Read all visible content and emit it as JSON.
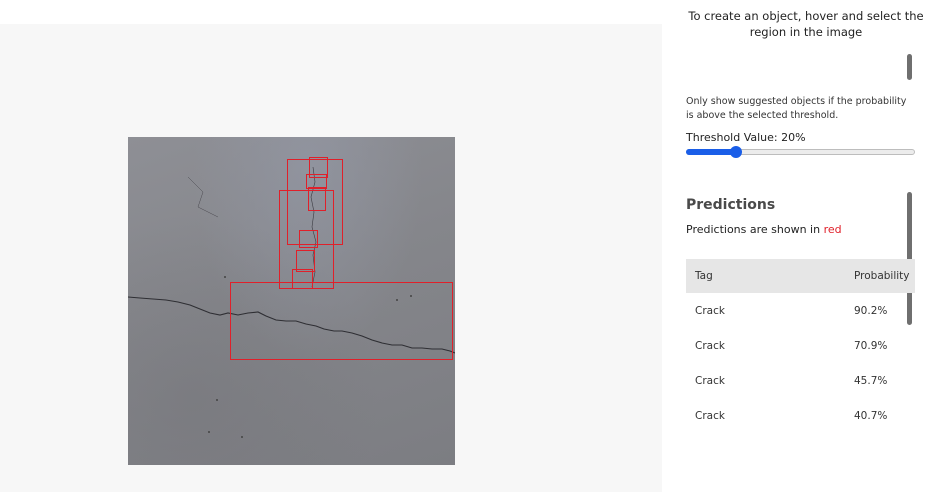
{
  "panel": {
    "instructions": "To create an object, hover and select the region in the image",
    "threshold_note": "Only show suggested objects if the probability is above the selected threshold.",
    "threshold_label": "Threshold Value: 20%",
    "threshold_value": 20
  },
  "predictions": {
    "title": "Predictions",
    "subtitle_prefix": "Predictions are shown in ",
    "subtitle_highlight": "red",
    "columns": [
      "Tag",
      "Probability"
    ],
    "rows": [
      {
        "tag": "Crack",
        "probability": "90.2%"
      },
      {
        "tag": "Crack",
        "probability": "70.9%"
      },
      {
        "tag": "Crack",
        "probability": "45.7%"
      },
      {
        "tag": "Crack",
        "probability": "40.7%"
      }
    ]
  },
  "colors": {
    "box_color": "#e0202a",
    "slider_color": "#1a5ee8"
  }
}
